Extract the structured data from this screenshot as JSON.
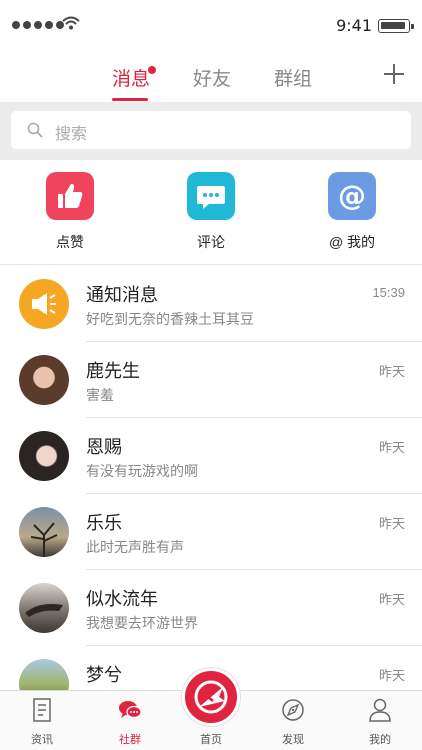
{
  "status_bar": {
    "time": "9:41"
  },
  "top_tabs": [
    {
      "label": "消息",
      "active": true
    },
    {
      "label": "好友",
      "active": false
    },
    {
      "label": "群组",
      "active": false
    }
  ],
  "search": {
    "placeholder": "搜索"
  },
  "quick_actions": [
    {
      "label": "点赞",
      "icon": "thumbs-up-icon",
      "color": "#f0445d"
    },
    {
      "label": "评论",
      "icon": "comment-icon",
      "color": "#1fb8d6"
    },
    {
      "label": "@ 我的",
      "icon": "at-sign-icon",
      "color": "#6a9be3"
    }
  ],
  "conversations": [
    {
      "name": "通知消息",
      "message": "好吃到无奈的香辣土耳其豆",
      "time": "15:39"
    },
    {
      "name": "鹿先生",
      "message": "害羞",
      "time": "昨天"
    },
    {
      "name": "恩赐",
      "message": "有没有玩游戏的啊",
      "time": "昨天"
    },
    {
      "name": "乐乐",
      "message": "此时无声胜有声",
      "time": "昨天"
    },
    {
      "name": "似水流年",
      "message": "我想要去环游世界",
      "time": "昨天"
    },
    {
      "name": "梦兮",
      "message": "",
      "time": "昨天"
    }
  ],
  "bottom_nav": [
    {
      "label": "资讯",
      "icon": "document-icon",
      "active": false
    },
    {
      "label": "社群",
      "icon": "chat-bubbles-icon",
      "active": true
    },
    {
      "label": "首页",
      "icon": "home-logo-icon",
      "active": false
    },
    {
      "label": "发现",
      "icon": "compass-icon",
      "active": false
    },
    {
      "label": "我的",
      "icon": "user-icon",
      "active": false
    }
  ],
  "colors": {
    "accent": "#e0243f",
    "notify_orange": "#f5a623"
  }
}
